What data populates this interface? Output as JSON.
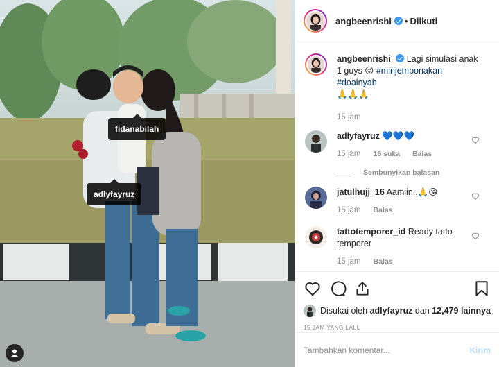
{
  "header": {
    "username": "angbeenrishi",
    "separator": "•",
    "follow_status": "Diikuti"
  },
  "photo": {
    "tags": [
      "fidanabilah",
      "adlyfayruz"
    ]
  },
  "caption": {
    "username": "angbeenrishi",
    "text": "Lagi simulasi anak 1 guys 😜",
    "hashtags": [
      "#minjemponakan",
      "#doainyah"
    ],
    "emoji_line": "🙏🙏🙏",
    "time": "15 jam"
  },
  "comments": [
    {
      "username": "adlyfayruz",
      "text": "💙💙💙",
      "time": "15 jam",
      "likes": "16 suka",
      "reply": "Balas"
    },
    {
      "username": "jatulhujj_16",
      "text": "Aamiin..🙏😘",
      "time": "15 jam",
      "reply": "Balas"
    },
    {
      "username": "tattotemporer_id",
      "text": "Ready tatto temporer",
      "time": "15 jam",
      "reply": "Balas"
    }
  ],
  "hide_replies": "Sembunyikan balasan",
  "likes": {
    "prefix": "Disukai oleh",
    "user": "adlyfayruz",
    "conj": "dan",
    "others": "12,479 lainnya"
  },
  "timestamp": "15 JAM YANG LALU",
  "add_comment": {
    "placeholder": "Tambahkan komentar...",
    "post_label": "Kirim"
  },
  "colors": {
    "verified": "#3897f0",
    "link": "#003569",
    "muted": "#8e8e8e",
    "post_button_disabled": "#b2dffc",
    "heart_blue": "#1e88e5"
  }
}
